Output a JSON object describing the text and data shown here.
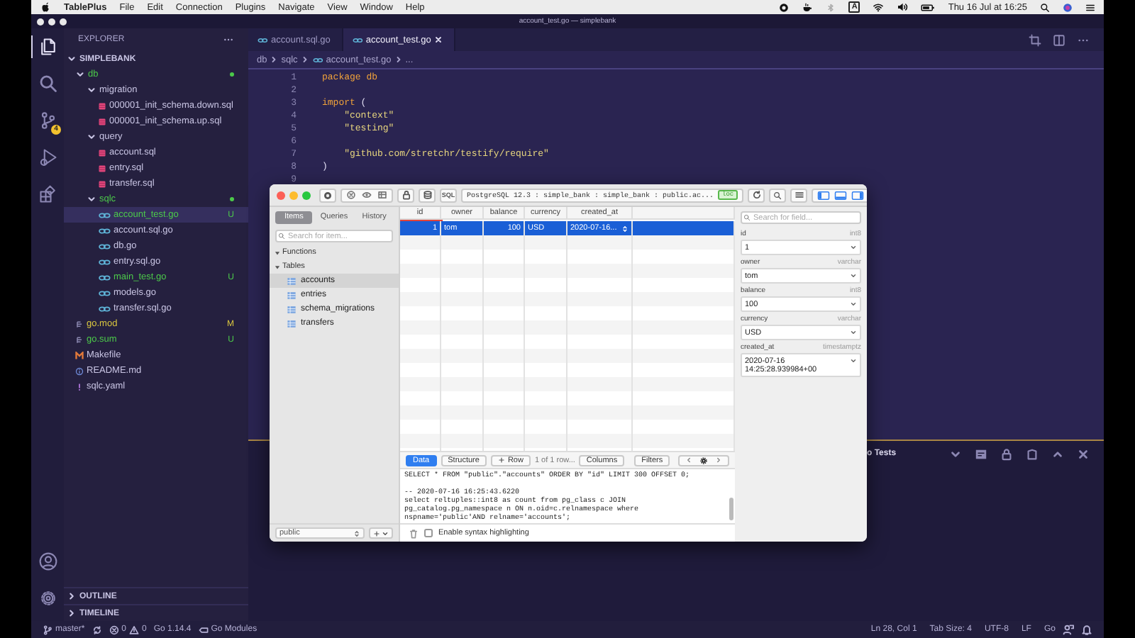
{
  "menubar": {
    "app": "TablePlus",
    "menus": [
      "File",
      "Edit",
      "Connection",
      "Plugins",
      "Navigate",
      "View",
      "Window",
      "Help"
    ],
    "input_source": "A",
    "clock": "Thu 16 Jul at 16:25"
  },
  "window": {
    "title": "account_test.go — simplebank"
  },
  "activity_bar": {
    "items": [
      {
        "kind": "files",
        "selected": true
      },
      {
        "kind": "search",
        "selected": false
      },
      {
        "kind": "source_control",
        "selected": false,
        "badge": "4"
      },
      {
        "kind": "run",
        "selected": false
      },
      {
        "kind": "extensions",
        "selected": false
      }
    ],
    "bottom": [
      {
        "kind": "account"
      },
      {
        "kind": "settings"
      }
    ]
  },
  "explorer": {
    "title": "EXPLORER",
    "root": {
      "label": "SIMPLEBANK",
      "expanded": true
    },
    "tree": [
      {
        "label": "db",
        "kind": "folder",
        "expanded": true,
        "selected": false,
        "color": "#4cc94a",
        "dot": true,
        "children": [
          {
            "label": "migration",
            "kind": "folder",
            "expanded": true,
            "selected": false,
            "color": "#c9c5e4",
            "children": [
              {
                "label": "000001_init_schema.down.sql",
                "kind": "sql",
                "selected": false,
                "color": "#c9c5e4"
              },
              {
                "label": "000001_init_schema.up.sql",
                "kind": "sql",
                "selected": false,
                "color": "#c9c5e4"
              }
            ]
          },
          {
            "label": "query",
            "kind": "folder",
            "expanded": true,
            "selected": false,
            "color": "#c9c5e4",
            "children": [
              {
                "label": "account.sql",
                "kind": "sql",
                "selected": false,
                "color": "#c9c5e4"
              },
              {
                "label": "entry.sql",
                "kind": "sql",
                "selected": false,
                "color": "#c9c5e4"
              },
              {
                "label": "transfer.sql",
                "kind": "sql",
                "selected": false,
                "color": "#c9c5e4"
              }
            ]
          },
          {
            "label": "sqlc",
            "kind": "folder",
            "expanded": true,
            "selected": false,
            "color": "#4cc94a",
            "dot": true,
            "children": [
              {
                "label": "account_test.go",
                "kind": "go",
                "selected": true,
                "color": "#4cc94a",
                "badge": "U"
              },
              {
                "label": "account.sql.go",
                "kind": "go",
                "selected": false,
                "color": "#c9c5e4"
              },
              {
                "label": "db.go",
                "kind": "go",
                "selected": false,
                "color": "#c9c5e4"
              },
              {
                "label": "entry.sql.go",
                "kind": "go",
                "selected": false,
                "color": "#c9c5e4"
              },
              {
                "label": "main_test.go",
                "kind": "go",
                "selected": false,
                "color": "#4cc94a",
                "badge": "U"
              },
              {
                "label": "models.go",
                "kind": "go",
                "selected": false,
                "color": "#c9c5e4"
              },
              {
                "label": "transfer.sql.go",
                "kind": "go",
                "selected": false,
                "color": "#c9c5e4"
              }
            ]
          }
        ]
      },
      {
        "label": "go.mod",
        "kind": "mod",
        "selected": false,
        "color": "#d9c63f",
        "badge": "M"
      },
      {
        "label": "go.sum",
        "kind": "mod",
        "selected": false,
        "color": "#4cc94a",
        "badge": "U"
      },
      {
        "label": "Makefile",
        "kind": "makefile",
        "selected": false,
        "color": "#c9c5e4"
      },
      {
        "label": "README.md",
        "kind": "readme",
        "selected": false,
        "color": "#c9c5e4"
      },
      {
        "label": "sqlc.yaml",
        "kind": "yaml",
        "selected": false,
        "color": "#c9c5e4"
      }
    ],
    "sections": [
      {
        "label": "OUTLINE",
        "expanded": false
      },
      {
        "label": "TIMELINE",
        "expanded": false
      }
    ]
  },
  "editor": {
    "tabs": [
      {
        "label": "account.sql.go",
        "selected": false
      },
      {
        "label": "account_test.go",
        "selected": true
      }
    ],
    "breadcrumb": [
      {
        "label": "db",
        "kind": "folder"
      },
      {
        "label": "sqlc",
        "kind": "folder"
      },
      {
        "label": "account_test.go",
        "kind": "go"
      },
      {
        "label": "...",
        "kind": "more"
      }
    ],
    "lines": [
      {
        "number": "1",
        "tokens": [
          {
            "text": "package ",
            "kind": "keyword"
          },
          {
            "text": "db",
            "kind": "name"
          }
        ]
      },
      {
        "number": "2"
      },
      {
        "number": "3",
        "tokens": [
          {
            "text": "import",
            "kind": "keyword"
          },
          {
            "text": " (",
            "kind": "plain"
          }
        ]
      },
      {
        "number": "4",
        "tokens": [
          {
            "text": "    \"context\"",
            "kind": "string"
          }
        ]
      },
      {
        "number": "5",
        "tokens": [
          {
            "text": "    \"testing\"",
            "kind": "string"
          }
        ]
      },
      {
        "number": "6"
      },
      {
        "number": "7",
        "tokens": [
          {
            "text": "    \"github.com/stretchr/testify/require\"",
            "kind": "string"
          }
        ]
      },
      {
        "number": "8",
        "tokens": [
          {
            "text": ")",
            "kind": "plain"
          }
        ]
      },
      {
        "number": "9"
      }
    ],
    "panel": {
      "title": "o Tests"
    }
  },
  "status_bar": {
    "branch": "master*",
    "errors": "0",
    "warnings": "0",
    "go_version": "Go 1.14.4",
    "modules": "Go Modules",
    "position": "Ln 28, Col 1",
    "tab_size": "Tab Size: 4",
    "encoding": "UTF-8",
    "eol": "LF",
    "language": "Go"
  },
  "tableplus": {
    "toolbar": {
      "sql": "SQL",
      "connection": "PostgreSQL 12.3 : simple_bank : simple_bank : public.ac...",
      "env": "loc"
    },
    "sidebar": {
      "tabs": [
        {
          "label": "Items",
          "selected": true
        },
        {
          "label": "Queries",
          "selected": false
        },
        {
          "label": "History",
          "selected": false
        }
      ],
      "search": {
        "placeholder": "Search for item..."
      },
      "groups": [
        {
          "label": "Functions",
          "expanded": true
        },
        {
          "label": "Tables",
          "expanded": true,
          "items": [
            {
              "label": "accounts",
              "selected": true
            },
            {
              "label": "entries",
              "selected": false
            },
            {
              "label": "schema_migrations",
              "selected": false
            },
            {
              "label": "transfers",
              "selected": false
            }
          ]
        }
      ],
      "schema": "public"
    },
    "grid": {
      "columns": [
        "id",
        "owner",
        "balance",
        "currency",
        "created_at"
      ],
      "rows": [
        {
          "cells": [
            "1",
            "tom",
            "100",
            "USD",
            "2020-07-16..."
          ],
          "selected": true
        }
      ]
    },
    "bottom_bar": {
      "views": [
        {
          "label": "Data",
          "selected": true
        },
        {
          "label": "Structure",
          "selected": false
        }
      ],
      "add_row": "Row",
      "row_count": "1 of 1 row...",
      "columns": "Columns",
      "filters": "Filters"
    },
    "console": {
      "lines": [
        "SELECT * FROM \"public\".\"accounts\" ORDER BY \"id\" LIMIT 300 OFFSET 0;",
        "-- 2020-07-16 16:25:43.6220",
        "select reltuples::int8 as count from pg_class c JOIN",
        "pg_catalog.pg_namespace n ON n.oid=c.relnamespace where",
        "nspname='public'AND relname='accounts';"
      ],
      "syntax_highlighting": {
        "label": "Enable syntax highlighting",
        "checked": false
      }
    },
    "detail": {
      "search": {
        "placeholder": "Search for field..."
      },
      "fields": [
        {
          "name": "id",
          "type": "int8",
          "value": "1"
        },
        {
          "name": "owner",
          "type": "varchar",
          "value": "tom"
        },
        {
          "name": "balance",
          "type": "int8",
          "value": "100"
        },
        {
          "name": "currency",
          "type": "varchar",
          "value": "USD"
        },
        {
          "name": "created_at",
          "type": "timestamptz",
          "value": "2020-07-16 14:25:28.939984+00"
        }
      ]
    }
  }
}
